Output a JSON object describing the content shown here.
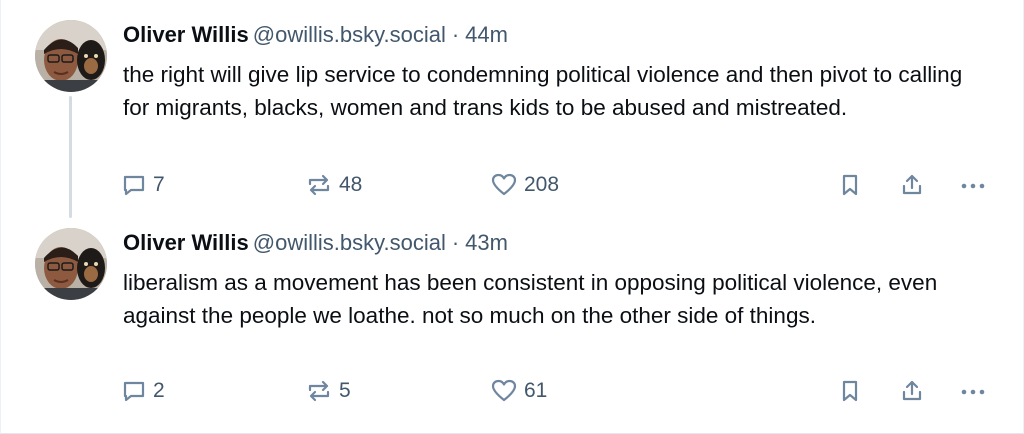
{
  "posts": [
    {
      "author_name": "Oliver Willis",
      "handle": "@owillis.bsky.social",
      "separator": "·",
      "time": "44m",
      "text": "the right will give lip service to condemning political violence and then pivot to calling for migrants, blacks, women and trans kids to be abused and mistreated.",
      "replies": "7",
      "reposts": "48",
      "likes": "208"
    },
    {
      "author_name": "Oliver Willis",
      "handle": "@owillis.bsky.social",
      "separator": "·",
      "time": "43m",
      "text": "liberalism as a movement has been consistent in opposing political violence, even against the people we loathe. not so much on the other side of things.",
      "replies": "2",
      "reposts": "5",
      "likes": "61"
    }
  ],
  "icons": {
    "reply": "speech-bubble-icon",
    "repost": "repost-arrows-icon",
    "like": "heart-icon",
    "bookmark": "bookmark-icon",
    "share": "share-icon",
    "more": "ellipsis-icon"
  },
  "colors": {
    "text": "#0b0f14",
    "muted": "#42576c",
    "icon": "#6f869f",
    "thread_line": "#d4dbe2"
  }
}
